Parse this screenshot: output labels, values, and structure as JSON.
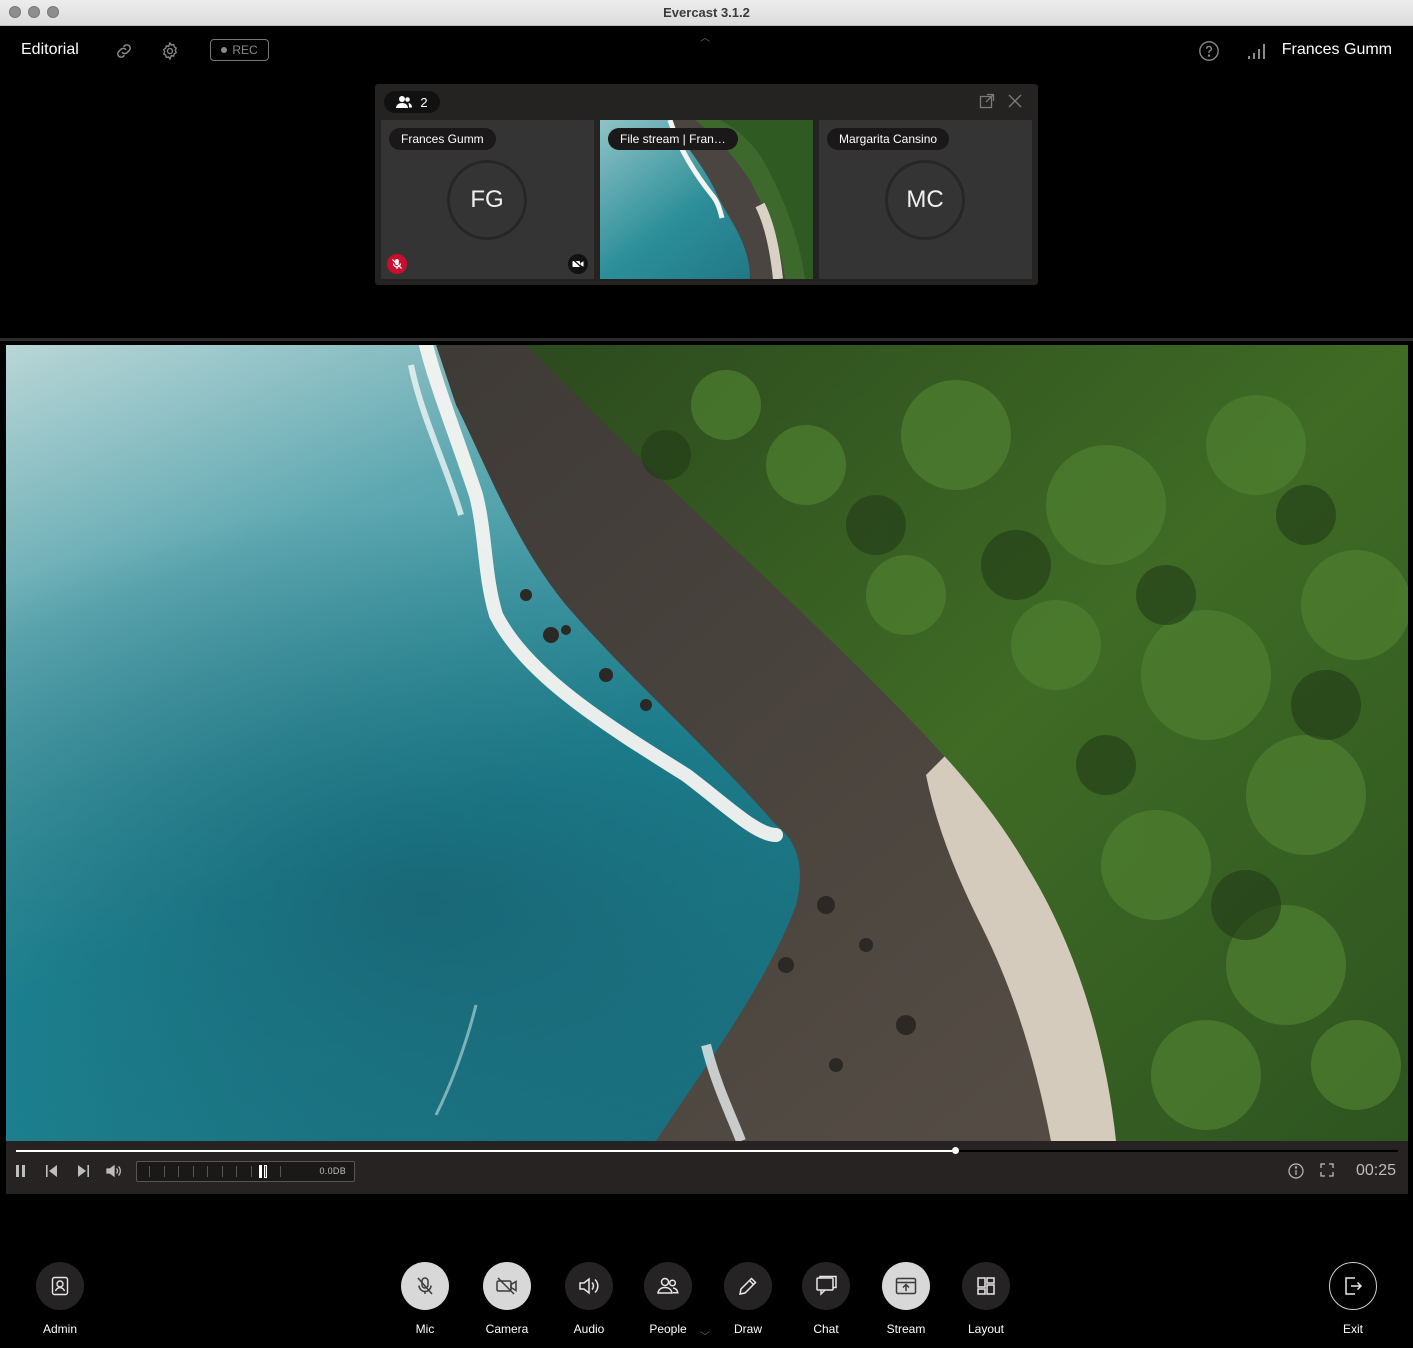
{
  "window": {
    "title": "Evercast 3.1.2"
  },
  "header": {
    "session_name": "Editorial",
    "rec_label": "REC",
    "user_name": "Frances Gumm"
  },
  "participants_panel": {
    "count": "2",
    "tiles": [
      {
        "label": "Frances Gumm",
        "initials": "FG",
        "mic_muted": true,
        "camera_off": true
      },
      {
        "label": "File stream | Fran…",
        "type": "stream"
      },
      {
        "label": "Margarita Cansino",
        "initials": "MC"
      }
    ]
  },
  "player": {
    "progress_fraction": 0.68,
    "audio_level_db": "0.0DB",
    "timecode": "00:25"
  },
  "toolbar": {
    "admin": "Admin",
    "mic": "Mic",
    "camera": "Camera",
    "audio": "Audio",
    "people": "People",
    "draw": "Draw",
    "chat": "Chat",
    "stream": "Stream",
    "layout": "Layout",
    "exit": "Exit"
  },
  "colors": {
    "background": "#000000",
    "panel": "#252222",
    "tile": "#353434",
    "mute_red": "#c8102e",
    "active_button": "#d8d8d8"
  }
}
